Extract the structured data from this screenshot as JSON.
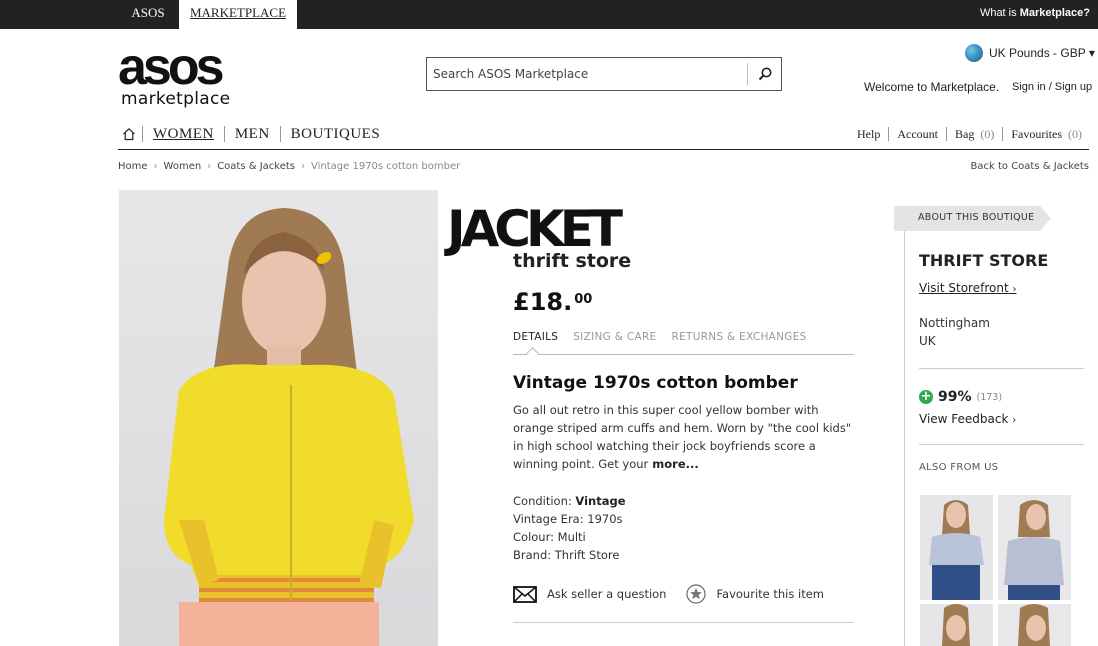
{
  "topbar": {
    "tabs": [
      {
        "label": "ASOS"
      },
      {
        "label": "MARKETPLACE"
      }
    ],
    "whatis_prefix": "What is",
    "whatis_strong": "Marketplace?"
  },
  "logo": {
    "main": "asos",
    "sub": "marketplace"
  },
  "search": {
    "placeholder": "Search ASOS Marketplace"
  },
  "header": {
    "currency": "UK Pounds - GBP ▾",
    "welcome": "Welcome to Marketplace.",
    "signin": "Sign in / Sign up"
  },
  "nav": {
    "items": [
      {
        "label": "WOMEN"
      },
      {
        "label": "MEN"
      },
      {
        "label": "BOUTIQUES"
      }
    ]
  },
  "utilnav": {
    "help": "Help",
    "account": "Account",
    "bag": "Bag",
    "bag_count": "(0)",
    "favourites": "Favourites",
    "fav_count": "(0)"
  },
  "breadcrumb": {
    "items": [
      "Home",
      "Women",
      "Coats & Jackets",
      "Vintage 1970s cotton bomber"
    ],
    "separator": "›",
    "back": "Back to Coats & Jackets"
  },
  "product": {
    "overlay_title": "JACKET",
    "boutique": "thrift store",
    "price_main": "£18.",
    "price_pence": "00",
    "tabs": [
      {
        "label": "DETAILS"
      },
      {
        "label": "SIZING & CARE"
      },
      {
        "label": "RETURNS & EXCHANGES"
      }
    ],
    "title": "Vintage 1970s cotton bomber",
    "description": "Go all out retro in this super cool yellow bomber with orange striped arm cuffs and hem. Worn by \"the cool kids\" in high school watching their jock boyfriends score a winning point. Get your",
    "more": "more...",
    "specs": {
      "condition_label": "Condition:",
      "condition_value": "Vintage",
      "era": "Vintage Era: 1970s",
      "colour": "Colour: Multi",
      "brand": "Brand: Thrift Store"
    },
    "ask": "Ask seller a question",
    "favourite": "Favourite this item"
  },
  "sidebar": {
    "about": "ABOUT THIS BOUTIQUE",
    "name": "THRIFT STORE",
    "visit": "Visit Storefront",
    "city": "Nottingham",
    "country": "UK",
    "rating": "99%",
    "rating_count": "(173)",
    "feedback": "View Feedback",
    "also": "ALSO FROM US"
  }
}
